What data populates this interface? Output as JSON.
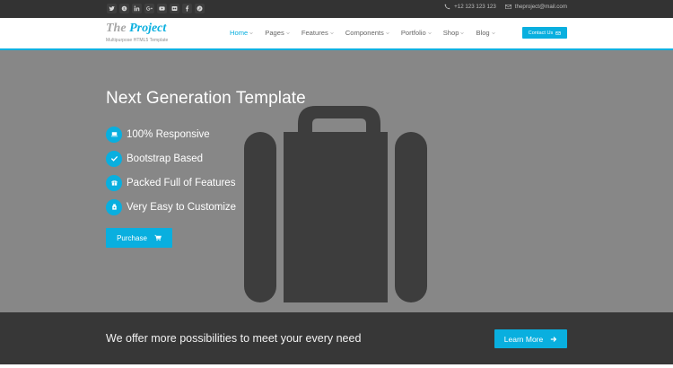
{
  "topbar": {
    "social_icons": [
      "twitter-icon",
      "skype-icon",
      "linkedin-icon",
      "googleplus-icon",
      "youtube-icon",
      "flickr-icon",
      "facebook-icon",
      "pinterest-icon"
    ],
    "phone": "+12 123 123 123",
    "email": "theproject@mail.com"
  },
  "header": {
    "logo_the": "The ",
    "logo_project": "Project",
    "tagline": "Multipurpose HTML5 Template",
    "nav": [
      {
        "label": "Home",
        "active": true
      },
      {
        "label": "Pages"
      },
      {
        "label": "Features"
      },
      {
        "label": "Components"
      },
      {
        "label": "Portfolio"
      },
      {
        "label": "Shop"
      },
      {
        "label": "Blog"
      }
    ],
    "contact_button": "Contact Us"
  },
  "hero": {
    "title": "Next Generation Template",
    "features": [
      {
        "label": "100% Responsive",
        "icon": "laptop-icon"
      },
      {
        "label": "Bootstrap Based",
        "icon": "check-icon"
      },
      {
        "label": "Packed Full of Features",
        "icon": "gift-icon"
      },
      {
        "label": "Very Easy to Customize",
        "icon": "puzzle-icon"
      }
    ],
    "purchase_button": "Purchase",
    "background_icon": "briefcase-icon"
  },
  "banner": {
    "text": "We offer more possibilities to meet your every need",
    "button": "Learn More"
  },
  "colors": {
    "accent": "#09afdf",
    "topbar": "#333333",
    "hero": "#878787",
    "banner": "#373737"
  }
}
